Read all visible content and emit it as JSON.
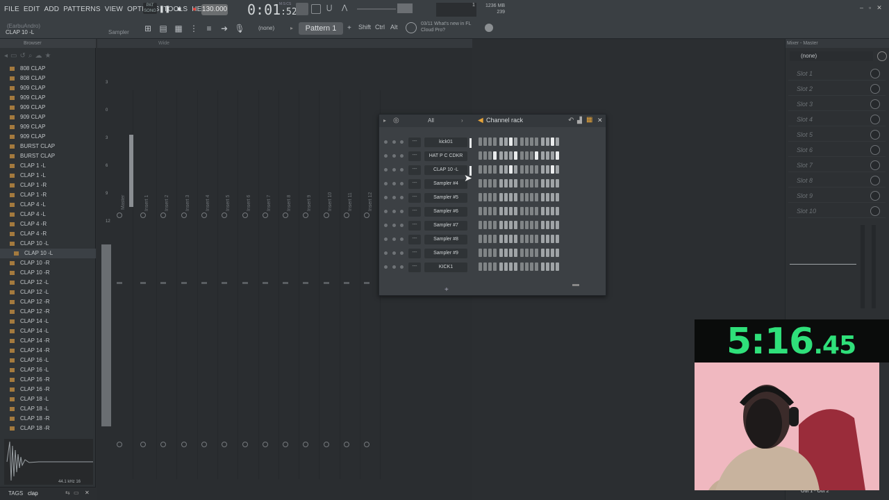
{
  "menu": [
    "FILE",
    "EDIT",
    "ADD",
    "PATTERNS",
    "VIEW",
    "OPTIONS",
    "TOOLS",
    "HELP"
  ],
  "transport": {
    "pat_song": "PAT\nSONG",
    "tempo": "130.000",
    "time_main": "0:01",
    "time_sub": ":52",
    "time_unit": "M:S:CS",
    "pattern": "Pattern 1",
    "pattern_none": "(none)",
    "shift": "Shift",
    "ctrl": "Ctrl",
    "alt": "Alt",
    "news_line1": "03/11  What's new in FL",
    "news_line2": "Cloud Pro?",
    "mem_mb": "1236 MB",
    "mem_val": "239",
    "cpu": "1"
  },
  "hint": {
    "line": "(EarbuAndro)",
    "title": "CLAP 10 -L",
    "sampler": "Sampler"
  },
  "browser": {
    "title": "Browser",
    "files": [
      "808 CLAP",
      "808 CLAP",
      "909 CLAP",
      "909 CLAP",
      "909 CLAP",
      "909 CLAP",
      "909 CLAP",
      "909 CLAP",
      "BURST CLAP",
      "BURST CLAP",
      "CLAP 1 -L",
      "CLAP 1 -L",
      "CLAP 1 -R",
      "CLAP 1 -R",
      "CLAP 4 -L",
      "CLAP 4 -L",
      "CLAP 4 -R",
      "CLAP 4 -R",
      "CLAP 10 -L",
      "CLAP 10 -L",
      "CLAP 10 -R",
      "CLAP 10 -R",
      "CLAP 12 -L",
      "CLAP 12 -L",
      "CLAP 12 -R",
      "CLAP 12 -R",
      "CLAP 14 -L",
      "CLAP 14 -L",
      "CLAP 14 -R",
      "CLAP 14 -R",
      "CLAP 16 -L",
      "CLAP 16 -L",
      "CLAP 16 -R",
      "CLAP 16 -R",
      "CLAP 18 -L",
      "CLAP 18 -L",
      "CLAP 18 -R",
      "CLAP 18 -R"
    ],
    "selected_index": 19,
    "sample_rate": "44.1 kHz 16",
    "tags_label": "TAGS",
    "search_value": "clap"
  },
  "mixer": {
    "wide": "Wide",
    "master": "Master",
    "inserts": [
      "Insert 1",
      "Insert 2",
      "Insert 3",
      "Insert 4",
      "Insert 5",
      "Insert 6",
      "Insert 7",
      "Insert 8",
      "Insert 9",
      "Insert 10",
      "Insert 11",
      "Insert 12"
    ],
    "meter_ticks": [
      "3",
      "0",
      "3",
      "6",
      "9",
      "12"
    ]
  },
  "channel_rack": {
    "title": "Channel rack",
    "filter": "All",
    "channels": [
      {
        "name": "kick01",
        "steps": [
          0,
          0,
          0,
          0,
          0,
          0,
          0,
          0,
          0,
          0,
          0,
          0,
          0,
          0,
          0,
          0
        ],
        "hot": [
          6,
          14
        ]
      },
      {
        "name": "HAT P C CDKR",
        "steps": [],
        "hot": [
          3,
          7,
          11,
          15
        ]
      },
      {
        "name": "CLAP 10 -L",
        "steps": [],
        "hot": [
          6,
          14
        ]
      },
      {
        "name": "Sampler #4",
        "steps": [],
        "hot": []
      },
      {
        "name": "Sampler #5",
        "steps": [],
        "hot": []
      },
      {
        "name": "Sampler #6",
        "steps": [],
        "hot": []
      },
      {
        "name": "Sampler #7",
        "steps": [],
        "hot": []
      },
      {
        "name": "Sampler #8",
        "steps": [],
        "hot": []
      },
      {
        "name": "Sampler #9",
        "steps": [],
        "hot": []
      },
      {
        "name": "KICK1",
        "steps": [],
        "hot": []
      }
    ],
    "mini_label": "---",
    "add": "+"
  },
  "mixer_panel": {
    "title": "Mixer - Master",
    "none": "(none)",
    "slots": [
      "Slot 1",
      "Slot 2",
      "Slot 3",
      "Slot 4",
      "Slot 5",
      "Slot 6",
      "Slot 7",
      "Slot 8",
      "Slot 9",
      "Slot 10"
    ],
    "out": "Out 1 - Out 2"
  },
  "timer": {
    "main": "5:16",
    "cs": ".45",
    "color": "#2fe07a"
  }
}
